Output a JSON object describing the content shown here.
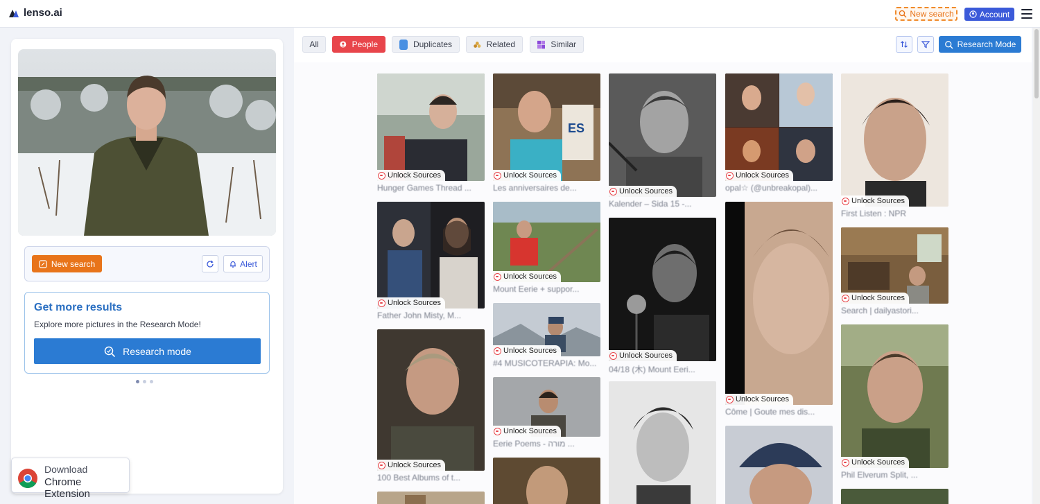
{
  "header": {
    "logo_text": "lenso.ai",
    "new_search_label": "New search",
    "account_label": "Account"
  },
  "sidebar": {
    "new_search_label": "New search",
    "alert_label": "Alert",
    "promo_title": "Get more results",
    "promo_subtitle": "Explore more pictures in the Research Mode!",
    "research_mode_label": "Research mode",
    "carousel_dots": 3,
    "carousel_active": 1,
    "extension_line1": "Download",
    "extension_line2": "Chrome Extension"
  },
  "filters": {
    "all": "All",
    "people": "People",
    "duplicates": "Duplicates",
    "related": "Related",
    "similar": "Similar",
    "research_mode": "Research Mode",
    "active": "People"
  },
  "badge_label": "Unlock Sources",
  "results": [
    {
      "title": "Hunger Games Thread ...",
      "color": "#6b7468"
    },
    {
      "title": "Father John Misty, M...",
      "color": "#3e3a3f"
    },
    {
      "title": "100 Best Albums of t...",
      "color": "#4a4238"
    },
    {
      "title": "Les anniversaires de...",
      "color": "#8a6f55"
    },
    {
      "title": "Mount Eerie + suppor...",
      "color": "#6a7a52"
    },
    {
      "title": "#4 MUSICOTERAPIA: Mo...",
      "color": "#b9c0c9"
    },
    {
      "title": "Eerie Poems - מורה ...",
      "color": "#7a7c80"
    },
    {
      "title": "Kalender – Sida 15 -...",
      "color": "#8c8c8c"
    },
    {
      "title": "04/18 (木) Mount Eeri...",
      "color": "#2a2a2a"
    },
    {
      "title": "opal☆ (@unbreakopal)...",
      "color": "#5a3a34"
    },
    {
      "title": "Côme | Goute mes dis...",
      "color": "#a8876a"
    },
    {
      "title": "First Listen : NPR",
      "color": "#b89a86"
    },
    {
      "title": "Search | dailyastori...",
      "color": "#6e5a40"
    },
    {
      "title": "Phil Elverum Split, ...",
      "color": "#6b6a4e"
    }
  ],
  "colors": {
    "brand_blue": "#3b5ad9",
    "orange": "#e8741a",
    "red_active": "#e8454b",
    "research_blue": "#2b7bd3"
  },
  "icons": [
    "search-icon",
    "account-icon",
    "menu-icon",
    "edit-search-icon",
    "refresh-icon",
    "alert-icon",
    "research-icon",
    "chrome-icon",
    "sort-icon",
    "filter-icon",
    "people-icon",
    "duplicates-icon",
    "related-icon",
    "similar-icon",
    "unlock-icon"
  ]
}
